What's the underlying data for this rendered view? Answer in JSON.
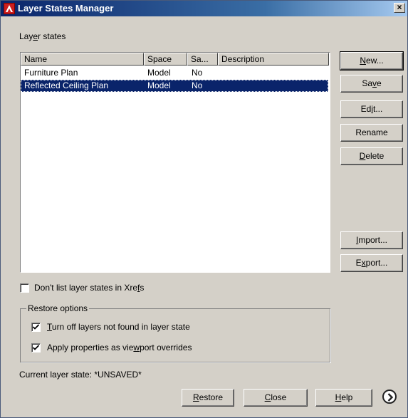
{
  "window": {
    "title": "Layer States Manager",
    "close_glyph": "×"
  },
  "layer_states_label": {
    "pre": "Lay",
    "key": "e",
    "post": "r states"
  },
  "list": {
    "columns": [
      "Name",
      "Space",
      "Sa...",
      "Description"
    ],
    "rows": [
      {
        "name": "Furniture Plan",
        "space": "Model",
        "saved": "No",
        "description": ""
      },
      {
        "name": "Reflected Ceiling Plan",
        "space": "Model",
        "saved": "No",
        "description": "",
        "selected": true
      }
    ]
  },
  "side_buttons": {
    "new": {
      "pre": "",
      "key": "N",
      "post": "ew..."
    },
    "save": {
      "pre": "Sa",
      "key": "v",
      "post": "e"
    },
    "edit": {
      "pre": "Ed",
      "key": "i",
      "post": "t..."
    },
    "rename": {
      "pre": "Rename",
      "key": "",
      "post": ""
    },
    "delete": {
      "pre": "",
      "key": "D",
      "post": "elete"
    },
    "import": {
      "pre": "",
      "key": "I",
      "post": "mport..."
    },
    "export": {
      "pre": "E",
      "key": "x",
      "post": "port..."
    }
  },
  "xrefs_checkbox": {
    "pre": "Don't list layer states in Xre",
    "key": "f",
    "post": "s",
    "checked": false
  },
  "restore_options": {
    "title": "Restore options",
    "turn_off": {
      "pre": "",
      "key": "T",
      "post": "urn off layers not found in layer state",
      "checked": true
    },
    "apply_props": {
      "pre": "Apply properties as vie",
      "key": "w",
      "post": "port overrides",
      "checked": true
    }
  },
  "current_state": "Current layer state: *UNSAVED*",
  "bottom_buttons": {
    "restore": {
      "pre": "",
      "key": "R",
      "post": "estore"
    },
    "close": {
      "pre": "",
      "key": "C",
      "post": "lose"
    },
    "help": {
      "pre": "",
      "key": "H",
      "post": "elp"
    }
  },
  "icons": {
    "app": "autocad-logo-icon",
    "expand": "chevron-right-circle-icon"
  },
  "colors": {
    "title_bar": "#0a246a",
    "selection": "#0a246a",
    "app_icon": "#cc1e1e"
  }
}
